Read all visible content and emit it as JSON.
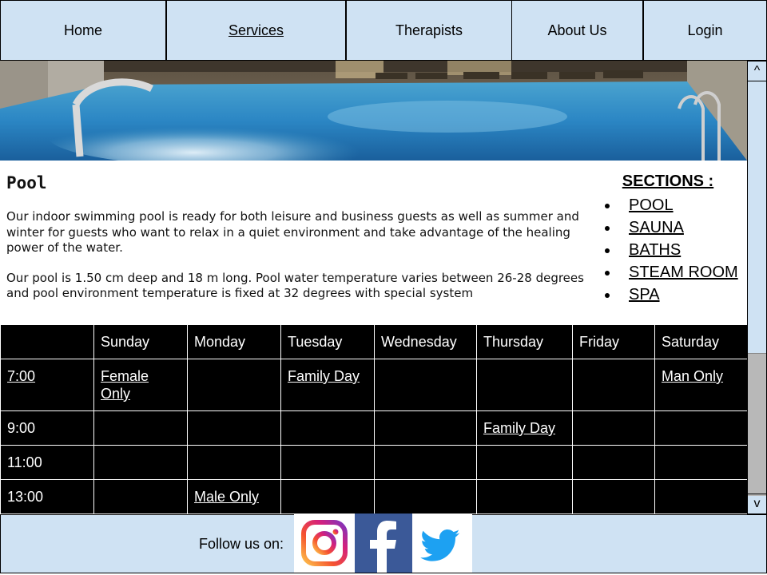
{
  "nav": {
    "items": [
      {
        "label": "Home"
      },
      {
        "label": "Services"
      },
      {
        "label": "Therapists"
      },
      {
        "label": "About Us"
      },
      {
        "label": "Login"
      }
    ],
    "active": "Services"
  },
  "main": {
    "title": "Pool",
    "paragraphs": [
      "Our indoor swimming pool is ready for both leisure and business guests as well as summer and winter for guests who want to relax in a quiet environment and take advantage of the healing power of the water.",
      "Our pool is 1.50 cm deep and 18 m long. Pool water temperature varies between 26-28 degrees and pool environment temperature is fixed at 32 degrees with special system"
    ]
  },
  "sections": {
    "title": "SECTIONS :",
    "items": [
      "POOL",
      "SAUNA",
      "BATHS",
      "STEAM ROOM",
      "SPA"
    ]
  },
  "schedule": {
    "days": [
      "Sunday",
      "Monday",
      "Tuesday",
      "Wednesday",
      "Thursday",
      "Friday",
      "Saturday"
    ],
    "rows": [
      {
        "time": "7:00",
        "cells": [
          "Female Only",
          "",
          "Family Day",
          "",
          "",
          "",
          "Man Only"
        ]
      },
      {
        "time": "9:00",
        "cells": [
          "",
          "",
          "",
          "",
          "Family Day",
          "",
          ""
        ]
      },
      {
        "time": "11:00",
        "cells": [
          "",
          "",
          "",
          "",
          "",
          "",
          ""
        ]
      },
      {
        "time": "13:00",
        "cells": [
          "",
          "Male Only",
          "",
          "",
          "",
          "",
          ""
        ]
      }
    ]
  },
  "scrollbar": {
    "up": "^",
    "down": "v"
  },
  "footer": {
    "follow_label": "Follow us on:",
    "social": [
      "instagram-icon",
      "facebook-icon",
      "twitter-icon"
    ]
  },
  "colors": {
    "nav_bg": "#cfe2f3",
    "schedule_bg": "#000000",
    "facebook": "#3b5998",
    "twitter": "#1da1f2"
  }
}
